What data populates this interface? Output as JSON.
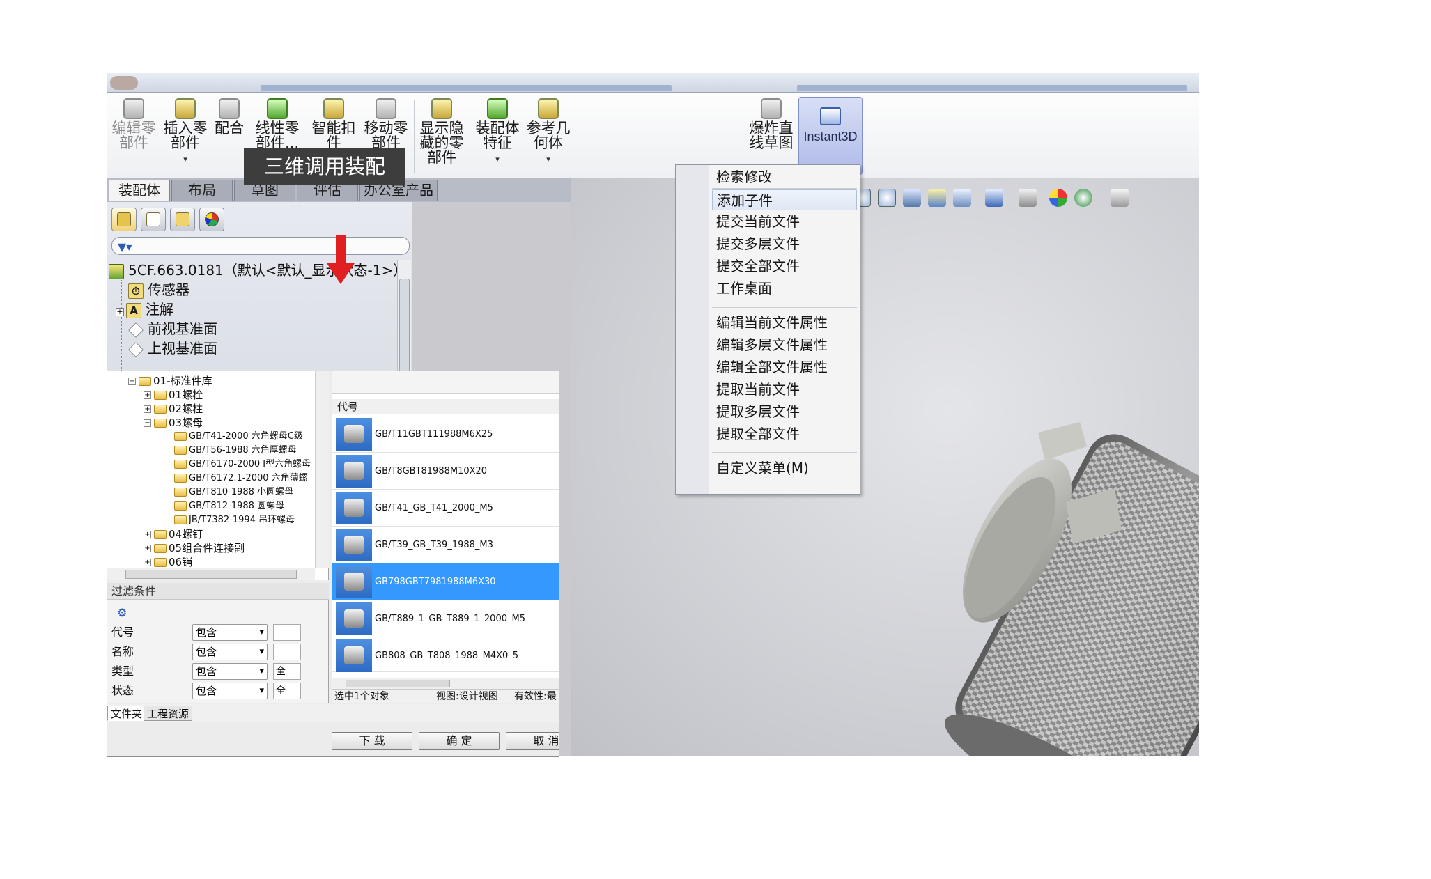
{
  "ribbon": {
    "buttons": [
      {
        "label": "编辑零\n部件",
        "icon": "edit-component-icon",
        "disabled": true
      },
      {
        "label": "插入零\n部件",
        "icon": "insert-component-icon",
        "caret": true
      },
      {
        "label": "配合",
        "icon": "mate-icon"
      },
      {
        "label": "线性零\n部件...",
        "icon": "linear-pattern-icon",
        "caret": true
      },
      {
        "label": "智能扣\n件",
        "icon": "smart-fastener-icon"
      },
      {
        "label": "移动零\n部件",
        "icon": "move-component-icon",
        "caret": true
      },
      {
        "label": "显示隐\n藏的零\n部件",
        "icon": "show-hidden-icon"
      },
      {
        "label": "装配体\n特征",
        "icon": "assembly-feature-icon",
        "caret": true
      },
      {
        "label": "参考几\n何体",
        "icon": "reference-geometry-icon",
        "caret": true
      },
      {
        "label": "爆炸直\n线草图",
        "icon": "explode-line-sketch-icon"
      }
    ],
    "instant3d": "Instant3D"
  },
  "tabs": [
    "装配体",
    "布局",
    "草图",
    "评估",
    "办公室产品"
  ],
  "callout": "三维调用装配",
  "feature_tree": {
    "root": "5CF.663.0181（默认<默认_显示状态-1>）",
    "items": [
      "传感器",
      "注解",
      "前视基准面",
      "上视基准面"
    ]
  },
  "menu": {
    "items": [
      "检索修改",
      "添加子件",
      "提交当前文件",
      "提交多层文件",
      "提交全部文件",
      "工作桌面",
      "编辑当前文件属性",
      "编辑多层文件属性",
      "编辑全部文件属性",
      "提取当前文件",
      "提取多层文件",
      "提取全部文件",
      "自定义菜单(M)"
    ],
    "hover_index": 1
  },
  "library": {
    "nodes": [
      {
        "label": "01-标准件库",
        "level": 0,
        "expanded": true
      },
      {
        "label": "01螺栓",
        "level": 1
      },
      {
        "label": "02螺柱",
        "level": 1
      },
      {
        "label": "03螺母",
        "level": 1,
        "expanded": true
      },
      {
        "label": "GB/T41-2000 六角螺母C级",
        "level": 2
      },
      {
        "label": "GB/T56-1988 六角厚螺母",
        "level": 2
      },
      {
        "label": "GB/T6170-2000 I型六角螺母",
        "level": 2
      },
      {
        "label": "GB/T6172.1-2000 六角薄螺",
        "level": 2
      },
      {
        "label": "GB/T810-1988 小圆螺母",
        "level": 2
      },
      {
        "label": "GB/T812-1988 圆螺母",
        "level": 2
      },
      {
        "label": "JB/T7382-1994 吊环螺母",
        "level": 2
      },
      {
        "label": "04螺钉",
        "level": 1
      },
      {
        "label": "05组合件连接副",
        "level": 1
      },
      {
        "label": "06销",
        "level": 1
      }
    ]
  },
  "filter": {
    "title": "过滤条件",
    "rows": [
      {
        "label": "代号",
        "op": "包含",
        "value": ""
      },
      {
        "label": "名称",
        "op": "包含",
        "value": ""
      },
      {
        "label": "类型",
        "op": "包含",
        "value": "全"
      },
      {
        "label": "状态",
        "op": "包含",
        "value": "全"
      }
    ]
  },
  "bottom_tabs": [
    "文件夹",
    "工程资源"
  ],
  "parts": {
    "column": "代号",
    "rows": [
      "GB/T11GBT111988M6X25",
      "GB/T8GBT81988M10X20",
      "GB/T41_GB_T41_2000_M5",
      "GB/T39_GB_T39_1988_M3",
      "GB798GBT7981988M6X30",
      "GB/T889_1_GB_T889_1_2000_M5",
      "GB808_GB_T808_1988_M4X0_5"
    ],
    "selected_index": 4
  },
  "status": {
    "selected": "选中1个对象",
    "view": "视图:设计视图",
    "validity": "有效性:最"
  },
  "buttons": {
    "download": "下 载",
    "ok": "确 定",
    "cancel": "取 消"
  }
}
